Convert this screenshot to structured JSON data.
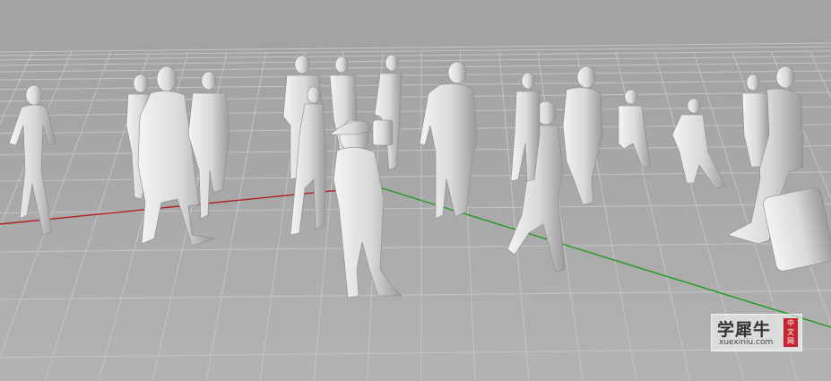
{
  "scene": {
    "background": "#a4a4a4",
    "grid_color": "#c4c4c4",
    "x_axis_color": "#b02020",
    "y_axis_color": "#1f9a1f",
    "figure_color": "#e6e6e6"
  },
  "watermark": {
    "title": "学犀牛",
    "url": "xuexiniu.com",
    "badge": [
      "中",
      "文",
      "网"
    ],
    "badge_color": "#c4262e"
  }
}
